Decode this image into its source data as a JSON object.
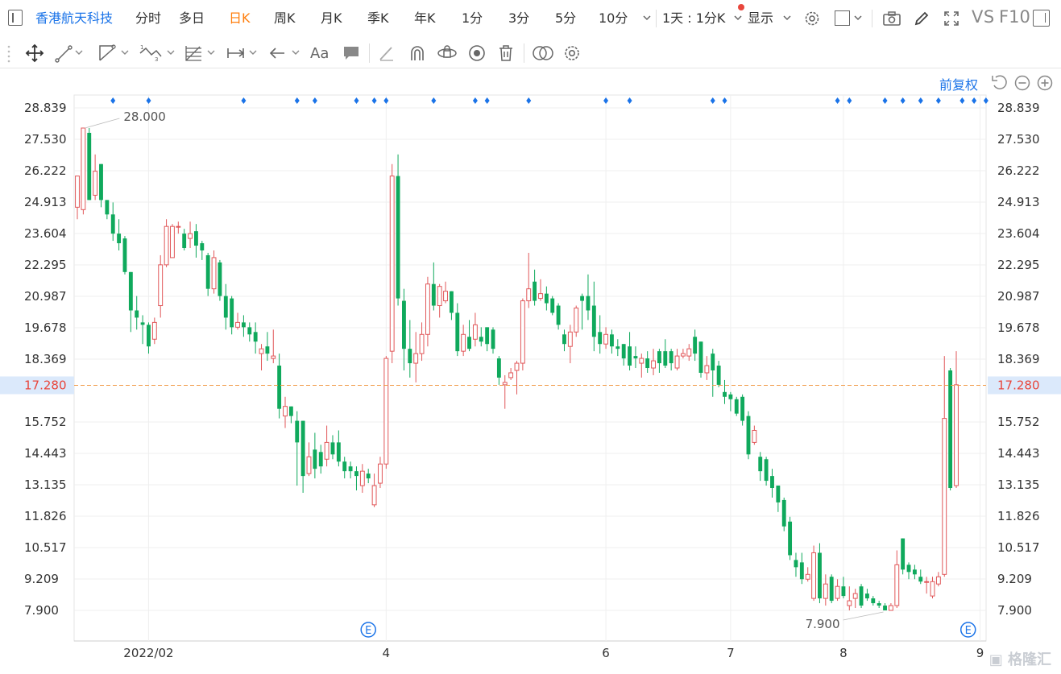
{
  "toolbar": {
    "stock_name": "香港航天科技",
    "periods": [
      "分时",
      "多日",
      "日K",
      "周K",
      "月K",
      "季K",
      "年K",
      "1分",
      "3分",
      "5分",
      "10分"
    ],
    "active_period": "日K",
    "interval_select": "1天 : 1分K",
    "display_label": "显示",
    "vs_label": "VS",
    "f10_label": "F10"
  },
  "toolbar2_icons": [
    "move-icon",
    "line-tool-icon",
    "channel-tool-icon",
    "wave-tool-icon",
    "fib-tool-icon",
    "measure-tool-icon",
    "arrow-tool-icon",
    "text-tool-icon",
    "comment-tool-icon",
    "pen-tool-icon",
    "magnet-icon",
    "lock-icon",
    "visibility-icon",
    "trash-icon",
    "compare-icon",
    "settings-icon"
  ],
  "fuquan_label": "前复权",
  "colors": {
    "up": "#e15759",
    "down": "#0fa95c",
    "accent": "#1a73e8",
    "current": "#e8463c",
    "dashed": "#f19a47"
  },
  "chart_data": {
    "type": "candlestick",
    "y_ticks": [
      "28.839",
      "27.530",
      "26.222",
      "24.913",
      "23.604",
      "22.295",
      "20.987",
      "19.678",
      "18.369",
      "17.280",
      "15.752",
      "14.443",
      "13.135",
      "11.826",
      "10.517",
      "9.209",
      "7.900"
    ],
    "ylim": [
      7.9,
      28.839
    ],
    "x_tick_labels": [
      "2022/02",
      "4",
      "6",
      "7",
      "8",
      "9"
    ],
    "current_price": "17.280",
    "max_label": "28.000",
    "min_label": "7.900",
    "event_marker": "E",
    "candles": [
      {
        "o": 24.7,
        "c": 26.0,
        "h": 26.0,
        "l": 24.2
      },
      {
        "o": 24.6,
        "c": 28.0,
        "h": 28.0,
        "l": 24.4
      },
      {
        "o": 27.8,
        "c": 25.0,
        "h": 28.0,
        "l": 25.0
      },
      {
        "o": 25.2,
        "c": 26.2,
        "h": 26.9,
        "l": 25.0
      },
      {
        "o": 26.5,
        "c": 25.0,
        "h": 26.5,
        "l": 24.7
      },
      {
        "o": 25.0,
        "c": 24.4,
        "h": 25.0,
        "l": 24.2
      },
      {
        "o": 24.4,
        "c": 23.6,
        "h": 24.9,
        "l": 23.3
      },
      {
        "o": 23.6,
        "c": 23.2,
        "h": 24.2,
        "l": 22.9
      },
      {
        "o": 23.4,
        "c": 22.0,
        "h": 23.5,
        "l": 21.9
      },
      {
        "o": 22.0,
        "c": 20.4,
        "h": 22.0,
        "l": 19.5
      },
      {
        "o": 20.4,
        "c": 20.1,
        "h": 21.0,
        "l": 19.6
      },
      {
        "o": 19.9,
        "c": 19.8,
        "h": 20.2,
        "l": 19.0
      },
      {
        "o": 19.8,
        "c": 18.9,
        "h": 19.9,
        "l": 18.6
      },
      {
        "o": 19.2,
        "c": 19.9,
        "h": 20.1,
        "l": 19.0
      },
      {
        "o": 20.6,
        "c": 22.3,
        "h": 22.7,
        "l": 20.1
      },
      {
        "o": 22.3,
        "c": 23.9,
        "h": 24.2,
        "l": 22.2
      },
      {
        "o": 22.6,
        "c": 23.9,
        "h": 24.0,
        "l": 22.6
      },
      {
        "o": 23.9,
        "c": 23.9,
        "h": 24.1,
        "l": 23.6
      },
      {
        "o": 23.6,
        "c": 23.0,
        "h": 23.8,
        "l": 22.9
      },
      {
        "o": 23.4,
        "c": 23.6,
        "h": 24.1,
        "l": 23.0
      },
      {
        "o": 23.7,
        "c": 23.1,
        "h": 24.0,
        "l": 22.6
      },
      {
        "o": 23.2,
        "c": 22.9,
        "h": 23.3,
        "l": 22.5
      },
      {
        "o": 22.7,
        "c": 21.3,
        "h": 22.8,
        "l": 21.0
      },
      {
        "o": 21.3,
        "c": 22.6,
        "h": 22.9,
        "l": 21.1
      },
      {
        "o": 22.4,
        "c": 21.0,
        "h": 22.5,
        "l": 20.8
      },
      {
        "o": 21.0,
        "c": 20.1,
        "h": 21.5,
        "l": 19.6
      },
      {
        "o": 20.9,
        "c": 19.7,
        "h": 21.0,
        "l": 19.4
      },
      {
        "o": 19.7,
        "c": 19.9,
        "h": 20.3,
        "l": 19.6
      },
      {
        "o": 19.9,
        "c": 19.7,
        "h": 20.2,
        "l": 19.3
      },
      {
        "o": 19.7,
        "c": 19.4,
        "h": 19.9,
        "l": 19.1
      },
      {
        "o": 19.5,
        "c": 19.1,
        "h": 19.9,
        "l": 18.6
      },
      {
        "o": 18.6,
        "c": 18.8,
        "h": 19.0,
        "l": 17.9
      },
      {
        "o": 18.9,
        "c": 18.6,
        "h": 19.5,
        "l": 18.3
      },
      {
        "o": 18.4,
        "c": 18.5,
        "h": 19.6,
        "l": 18.2
      },
      {
        "o": 18.1,
        "c": 16.3,
        "h": 18.6,
        "l": 15.9
      },
      {
        "o": 16.0,
        "c": 16.4,
        "h": 16.8,
        "l": 15.5
      },
      {
        "o": 16.4,
        "c": 16.0,
        "h": 16.4,
        "l": 15.7
      },
      {
        "o": 15.8,
        "c": 14.9,
        "h": 16.2,
        "l": 13.1
      },
      {
        "o": 15.8,
        "c": 13.5,
        "h": 15.8,
        "l": 12.8
      },
      {
        "o": 13.6,
        "c": 14.3,
        "h": 14.9,
        "l": 13.5
      },
      {
        "o": 14.6,
        "c": 13.8,
        "h": 15.3,
        "l": 13.4
      },
      {
        "o": 14.5,
        "c": 13.9,
        "h": 14.8,
        "l": 13.6
      },
      {
        "o": 14.2,
        "c": 14.9,
        "h": 15.6,
        "l": 13.9
      },
      {
        "o": 14.9,
        "c": 14.4,
        "h": 15.2,
        "l": 14.2
      },
      {
        "o": 14.9,
        "c": 14.1,
        "h": 15.4,
        "l": 13.9
      },
      {
        "o": 14.1,
        "c": 13.7,
        "h": 14.3,
        "l": 13.4
      },
      {
        "o": 13.9,
        "c": 13.7,
        "h": 14.1,
        "l": 13.4
      },
      {
        "o": 13.7,
        "c": 13.5,
        "h": 13.9,
        "l": 12.9
      },
      {
        "o": 13.1,
        "c": 13.7,
        "h": 14.0,
        "l": 12.8
      },
      {
        "o": 13.6,
        "c": 13.4,
        "h": 13.8,
        "l": 13.2
      },
      {
        "o": 12.3,
        "c": 13.1,
        "h": 13.6,
        "l": 12.2
      },
      {
        "o": 13.2,
        "c": 14.0,
        "h": 14.3,
        "l": 13.0
      },
      {
        "o": 14.0,
        "c": 18.4,
        "h": 18.5,
        "l": 13.8
      },
      {
        "o": 18.7,
        "c": 26.0,
        "h": 26.5,
        "l": 18.2
      },
      {
        "o": 26.0,
        "c": 20.9,
        "h": 26.9,
        "l": 20.6
      },
      {
        "o": 20.8,
        "c": 18.8,
        "h": 21.3,
        "l": 17.9
      },
      {
        "o": 18.8,
        "c": 18.2,
        "h": 20.0,
        "l": 17.6
      },
      {
        "o": 18.2,
        "c": 18.6,
        "h": 19.5,
        "l": 17.4
      },
      {
        "o": 18.6,
        "c": 19.4,
        "h": 19.9,
        "l": 18.3
      },
      {
        "o": 19.4,
        "c": 21.5,
        "h": 21.8,
        "l": 18.9
      },
      {
        "o": 21.5,
        "c": 20.6,
        "h": 22.4,
        "l": 20.4
      },
      {
        "o": 20.6,
        "c": 21.4,
        "h": 21.5,
        "l": 20.1
      },
      {
        "o": 20.8,
        "c": 21.2,
        "h": 21.6,
        "l": 20.7
      },
      {
        "o": 21.2,
        "c": 20.3,
        "h": 21.2,
        "l": 20.0
      },
      {
        "o": 20.3,
        "c": 18.7,
        "h": 20.7,
        "l": 18.5
      },
      {
        "o": 18.7,
        "c": 19.4,
        "h": 19.8,
        "l": 18.5
      },
      {
        "o": 19.3,
        "c": 18.8,
        "h": 20.0,
        "l": 18.7
      },
      {
        "o": 19.2,
        "c": 19.8,
        "h": 20.3,
        "l": 18.9
      },
      {
        "o": 19.3,
        "c": 19.1,
        "h": 19.7,
        "l": 18.9
      },
      {
        "o": 19.7,
        "c": 19.0,
        "h": 19.7,
        "l": 18.7
      },
      {
        "o": 19.6,
        "c": 18.8,
        "h": 19.7,
        "l": 18.6
      },
      {
        "o": 18.4,
        "c": 17.6,
        "h": 18.5,
        "l": 17.3
      },
      {
        "o": 17.3,
        "c": 17.4,
        "h": 17.7,
        "l": 16.3
      },
      {
        "o": 17.6,
        "c": 17.8,
        "h": 18.0,
        "l": 17.5
      },
      {
        "o": 17.9,
        "c": 18.2,
        "h": 18.3,
        "l": 16.9
      },
      {
        "o": 18.2,
        "c": 20.8,
        "h": 20.9,
        "l": 17.9
      },
      {
        "o": 20.8,
        "c": 21.3,
        "h": 22.8,
        "l": 20.5
      },
      {
        "o": 21.6,
        "c": 20.8,
        "h": 22.1,
        "l": 20.6
      },
      {
        "o": 20.9,
        "c": 21.1,
        "h": 21.7,
        "l": 20.8
      },
      {
        "o": 21.1,
        "c": 20.7,
        "h": 21.4,
        "l": 20.4
      },
      {
        "o": 20.9,
        "c": 20.3,
        "h": 21.0,
        "l": 20.2
      },
      {
        "o": 20.6,
        "c": 19.8,
        "h": 20.7,
        "l": 19.6
      },
      {
        "o": 19.4,
        "c": 19.0,
        "h": 19.6,
        "l": 18.7
      },
      {
        "o": 18.9,
        "c": 19.5,
        "h": 19.8,
        "l": 18.2
      },
      {
        "o": 19.5,
        "c": 20.5,
        "h": 20.6,
        "l": 19.3
      },
      {
        "o": 21.0,
        "c": 20.8,
        "h": 21.1,
        "l": 19.6
      },
      {
        "o": 21.0,
        "c": 20.4,
        "h": 21.9,
        "l": 20.0
      },
      {
        "o": 20.6,
        "c": 19.3,
        "h": 21.6,
        "l": 18.7
      },
      {
        "o": 19.5,
        "c": 19.0,
        "h": 20.2,
        "l": 18.6
      },
      {
        "o": 19.0,
        "c": 19.4,
        "h": 19.7,
        "l": 18.8
      },
      {
        "o": 19.4,
        "c": 18.9,
        "h": 19.6,
        "l": 18.6
      },
      {
        "o": 18.9,
        "c": 18.8,
        "h": 19.2,
        "l": 18.5
      },
      {
        "o": 19.0,
        "c": 18.4,
        "h": 19.0,
        "l": 18.1
      },
      {
        "o": 18.9,
        "c": 18.1,
        "h": 19.5,
        "l": 17.9
      },
      {
        "o": 18.5,
        "c": 18.4,
        "h": 18.9,
        "l": 18.0
      },
      {
        "o": 18.2,
        "c": 18.4,
        "h": 18.6,
        "l": 17.6
      },
      {
        "o": 18.4,
        "c": 18.0,
        "h": 18.7,
        "l": 17.8
      },
      {
        "o": 18.0,
        "c": 18.3,
        "h": 18.8,
        "l": 17.7
      },
      {
        "o": 18.7,
        "c": 18.2,
        "h": 18.8,
        "l": 17.8
      },
      {
        "o": 18.7,
        "c": 18.1,
        "h": 19.2,
        "l": 18.0
      },
      {
        "o": 18.7,
        "c": 18.2,
        "h": 18.8,
        "l": 17.9
      },
      {
        "o": 18.0,
        "c": 18.5,
        "h": 18.8,
        "l": 17.9
      },
      {
        "o": 18.5,
        "c": 18.6,
        "h": 18.8,
        "l": 18.4
      },
      {
        "o": 18.5,
        "c": 18.8,
        "h": 19.0,
        "l": 18.3
      },
      {
        "o": 19.3,
        "c": 18.6,
        "h": 19.6,
        "l": 18.3
      },
      {
        "o": 19.1,
        "c": 17.8,
        "h": 19.1,
        "l": 17.6
      },
      {
        "o": 17.8,
        "c": 18.1,
        "h": 18.5,
        "l": 17.5
      },
      {
        "o": 18.6,
        "c": 17.9,
        "h": 18.8,
        "l": 16.8
      },
      {
        "o": 18.1,
        "c": 17.3,
        "h": 18.3,
        "l": 17.2
      },
      {
        "o": 17.0,
        "c": 16.8,
        "h": 17.5,
        "l": 16.5
      },
      {
        "o": 16.9,
        "c": 16.7,
        "h": 17.0,
        "l": 16.2
      },
      {
        "o": 16.7,
        "c": 16.1,
        "h": 16.8,
        "l": 16.0
      },
      {
        "o": 16.8,
        "c": 15.8,
        "h": 16.9,
        "l": 15.6
      },
      {
        "o": 16.0,
        "c": 14.4,
        "h": 16.2,
        "l": 14.2
      },
      {
        "o": 14.9,
        "c": 15.4,
        "h": 15.6,
        "l": 14.8
      },
      {
        "o": 14.3,
        "c": 13.7,
        "h": 14.5,
        "l": 13.3
      },
      {
        "o": 14.2,
        "c": 13.3,
        "h": 14.3,
        "l": 13.1
      },
      {
        "o": 13.5,
        "c": 13.0,
        "h": 13.8,
        "l": 12.6
      },
      {
        "o": 13.1,
        "c": 12.4,
        "h": 13.1,
        "l": 12.0
      },
      {
        "o": 12.5,
        "c": 11.4,
        "h": 12.6,
        "l": 11.2
      },
      {
        "o": 11.6,
        "c": 10.2,
        "h": 11.8,
        "l": 10.0
      },
      {
        "o": 10.0,
        "c": 9.7,
        "h": 10.3,
        "l": 9.3
      },
      {
        "o": 9.9,
        "c": 9.2,
        "h": 10.3,
        "l": 9.0
      },
      {
        "o": 9.2,
        "c": 9.4,
        "h": 9.7,
        "l": 9.1
      },
      {
        "o": 8.4,
        "c": 10.3,
        "h": 10.6,
        "l": 8.3
      },
      {
        "o": 10.3,
        "c": 8.4,
        "h": 10.7,
        "l": 8.2
      },
      {
        "o": 8.4,
        "c": 9.0,
        "h": 9.4,
        "l": 8.1
      },
      {
        "o": 9.3,
        "c": 8.3,
        "h": 9.4,
        "l": 8.2
      },
      {
        "o": 8.4,
        "c": 8.9,
        "h": 9.2,
        "l": 8.3
      },
      {
        "o": 8.9,
        "c": 8.5,
        "h": 9.3,
        "l": 8.4
      },
      {
        "o": 8.1,
        "c": 8.3,
        "h": 8.9,
        "l": 7.9
      },
      {
        "o": 8.4,
        "c": 8.6,
        "h": 8.8,
        "l": 8.0
      },
      {
        "o": 8.9,
        "c": 8.1,
        "h": 9.0,
        "l": 8.0
      },
      {
        "o": 8.6,
        "c": 8.4,
        "h": 8.8,
        "l": 8.3
      },
      {
        "o": 8.4,
        "c": 8.2,
        "h": 8.5,
        "l": 8.1
      },
      {
        "o": 8.2,
        "c": 8.1,
        "h": 8.3,
        "l": 8.0
      },
      {
        "o": 8.1,
        "c": 7.9,
        "h": 8.2,
        "l": 7.9
      },
      {
        "o": 7.9,
        "c": 8.1,
        "h": 8.2,
        "l": 7.9
      },
      {
        "o": 8.1,
        "c": 9.8,
        "h": 10.4,
        "l": 8.0
      },
      {
        "o": 10.9,
        "c": 9.6,
        "h": 10.9,
        "l": 9.4
      },
      {
        "o": 9.8,
        "c": 9.5,
        "h": 9.9,
        "l": 9.2
      },
      {
        "o": 9.6,
        "c": 9.4,
        "h": 9.8,
        "l": 9.2
      },
      {
        "o": 9.3,
        "c": 9.1,
        "h": 9.6,
        "l": 9.0
      },
      {
        "o": 9.1,
        "c": 9.1,
        "h": 9.3,
        "l": 8.6
      },
      {
        "o": 8.5,
        "c": 9.1,
        "h": 9.3,
        "l": 8.4
      },
      {
        "o": 9.0,
        "c": 9.3,
        "h": 9.5,
        "l": 8.9
      },
      {
        "o": 9.4,
        "c": 15.9,
        "h": 18.5,
        "l": 9.3
      },
      {
        "o": 17.9,
        "c": 13.0,
        "h": 18.0,
        "l": 12.9
      },
      {
        "o": 13.1,
        "c": 17.3,
        "h": 18.7,
        "l": 13.0
      }
    ]
  }
}
